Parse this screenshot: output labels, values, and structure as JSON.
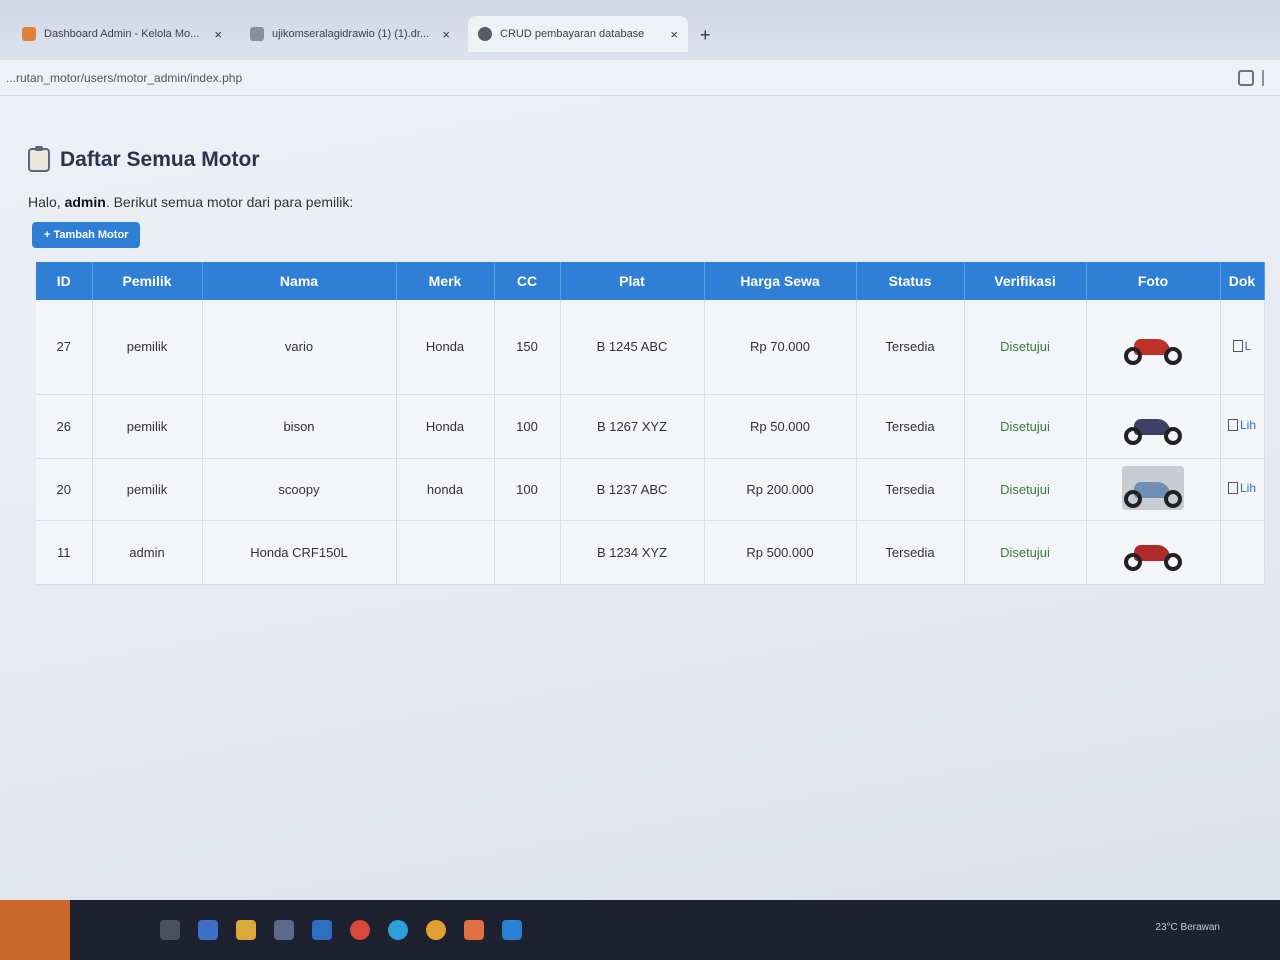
{
  "browser": {
    "tabs": [
      {
        "title": "Dashboard Admin - Kelola Mo...",
        "favicon_color": "#e0803c",
        "active": false
      },
      {
        "title": "ujikomseralagidrawio (1) (1).dr...",
        "favicon_color": "#8a8f99",
        "active": false
      },
      {
        "title": "CRUD pembayaran database",
        "favicon_color": "#555c69",
        "active": true
      }
    ],
    "close_glyph": "×",
    "new_tab_glyph": "+",
    "url": "...rutan_motor/users/motor_admin/index.php"
  },
  "page": {
    "title": "Daftar Semua Motor",
    "greeting_prefix": "Halo, ",
    "greeting_user": "admin",
    "greeting_suffix": ". Berikut semua motor dari para pemilik:",
    "add_button": "+ Tambah Motor"
  },
  "table": {
    "headers": [
      "ID",
      "Pemilik",
      "Nama",
      "Merk",
      "CC",
      "Plat",
      "Harga Sewa",
      "Status",
      "Verifikasi",
      "Foto",
      "Dok"
    ],
    "rows": [
      {
        "id": "27",
        "pemilik": "pemilik",
        "nama": "vario",
        "merk": "Honda",
        "cc": "150",
        "plat": "B 1245 ABC",
        "harga": "Rp 70.000",
        "status": "Tersedia",
        "verifikasi": "Disetujui",
        "foto_color": "#c0302a",
        "dok": "L"
      },
      {
        "id": "26",
        "pemilik": "pemilik",
        "nama": "bison",
        "merk": "Honda",
        "cc": "100",
        "plat": "B 1267 XYZ",
        "harga": "Rp 50.000",
        "status": "Tersedia",
        "verifikasi": "Disetujui",
        "foto_color": "#3b4166",
        "dok": "Lih"
      },
      {
        "id": "20",
        "pemilik": "pemilik",
        "nama": "scoopy",
        "merk": "honda",
        "cc": "100",
        "plat": "B 1237 ABC",
        "harga": "Rp 200.000",
        "status": "Tersedia",
        "verifikasi": "Disetujui",
        "foto_color": "#6f8fb0",
        "dok": "Lih"
      },
      {
        "id": "11",
        "pemilik": "admin",
        "nama": "Honda CRF150L",
        "merk": "",
        "cc": "",
        "plat": "B 1234 XYZ",
        "harga": "Rp 500.000",
        "status": "Tersedia",
        "verifikasi": "Disetujui",
        "foto_color": "#b02a2a",
        "dok": ""
      }
    ]
  },
  "colors": {
    "header_blue": "#2f7fd6",
    "verifikasi_text": "#3a7a3a"
  },
  "taskbar": {
    "tray_text": "23°C  Berawan"
  }
}
